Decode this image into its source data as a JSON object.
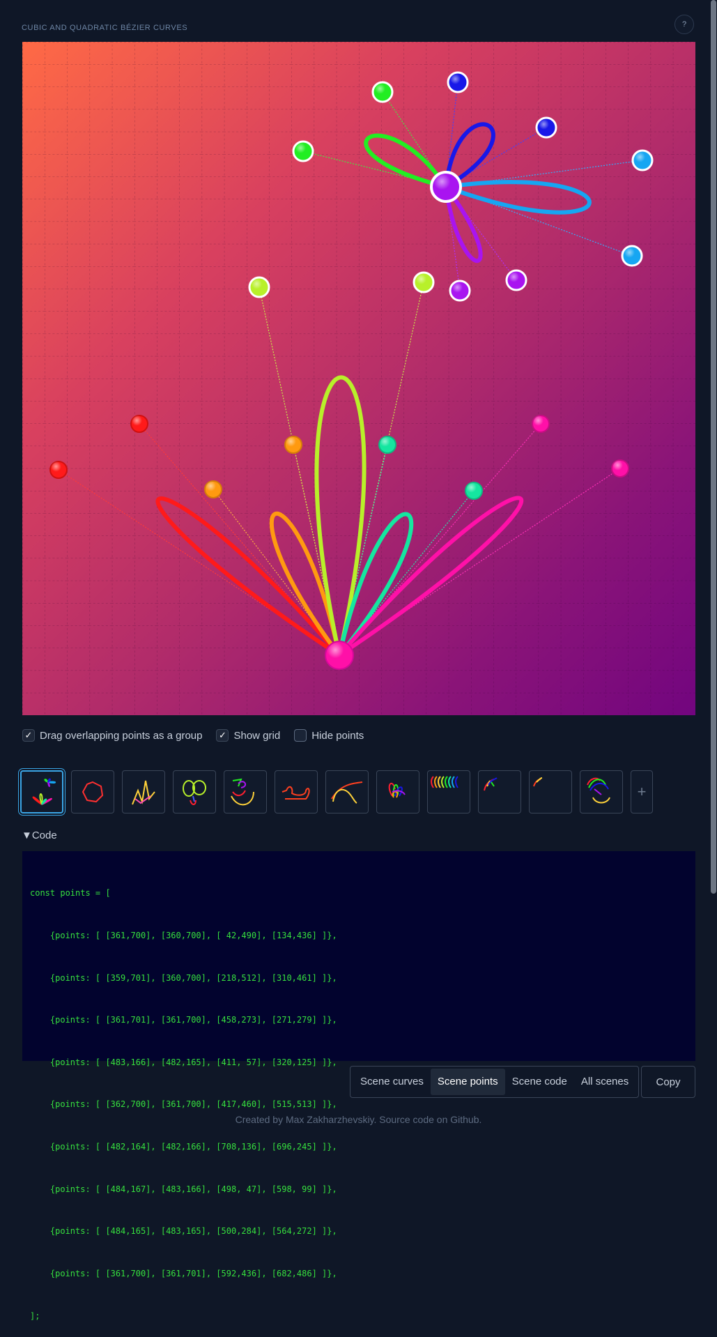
{
  "page": {
    "title": "CUBIC AND QUADRATIC BÉZIER CURVES",
    "help_label": "?"
  },
  "colors": {
    "background": "#0f1727",
    "canvas_gradient": [
      "#ff6a45",
      "#d8405f",
      "#b22c6a",
      "#8a1478",
      "#72057f"
    ],
    "red": "#ff1a1a",
    "orange": "#ff9a10",
    "lime": "#b8f02a",
    "green": "#22ee22",
    "teal": "#15e6a0",
    "pink": "#ff10a8",
    "purple": "#a914f0",
    "blue": "#1818e8",
    "sky": "#16a6f2",
    "active_scene": "#3ba6e6",
    "code_text": "#36e03e"
  },
  "options": {
    "drag_group": {
      "label": "Drag overlapping points as a group",
      "checked": true
    },
    "show_grid": {
      "label": "Show grid",
      "checked": true
    },
    "hide_points": {
      "label": "Hide points",
      "checked": false
    }
  },
  "scenes": {
    "count": 12,
    "active_index": 0,
    "add_label": "+"
  },
  "code": {
    "toggle_label": "▼Code",
    "lines": [
      "const points = [",
      "    {points: [ [361,700], [360,700], [ 42,490], [134,436] ]},",
      "    {points: [ [359,701], [360,700], [218,512], [310,461] ]},",
      "    {points: [ [361,701], [361,700], [458,273], [271,279] ]},",
      "    {points: [ [483,166], [482,165], [411, 57], [320,125] ]},",
      "    {points: [ [362,700], [361,700], [417,460], [515,513] ]},",
      "    {points: [ [482,164], [482,166], [708,136], [696,245] ]},",
      "    {points: [ [484,167], [483,166], [498, 47], [598, 99] ]},",
      "    {points: [ [484,165], [483,165], [500,284], [564,272] ]},",
      "    {points: [ [361,700], [361,701], [592,436], [682,486] ]},",
      "];"
    ]
  },
  "tabs": [
    {
      "label": "Scene curves",
      "active": false
    },
    {
      "label": "Scene points",
      "active": true
    },
    {
      "label": "Scene code",
      "active": false
    },
    {
      "label": "All scenes",
      "active": false
    }
  ],
  "copy_label": "Copy",
  "footer": "Created by Max Zakharzhevskiy. Source code on Github."
}
